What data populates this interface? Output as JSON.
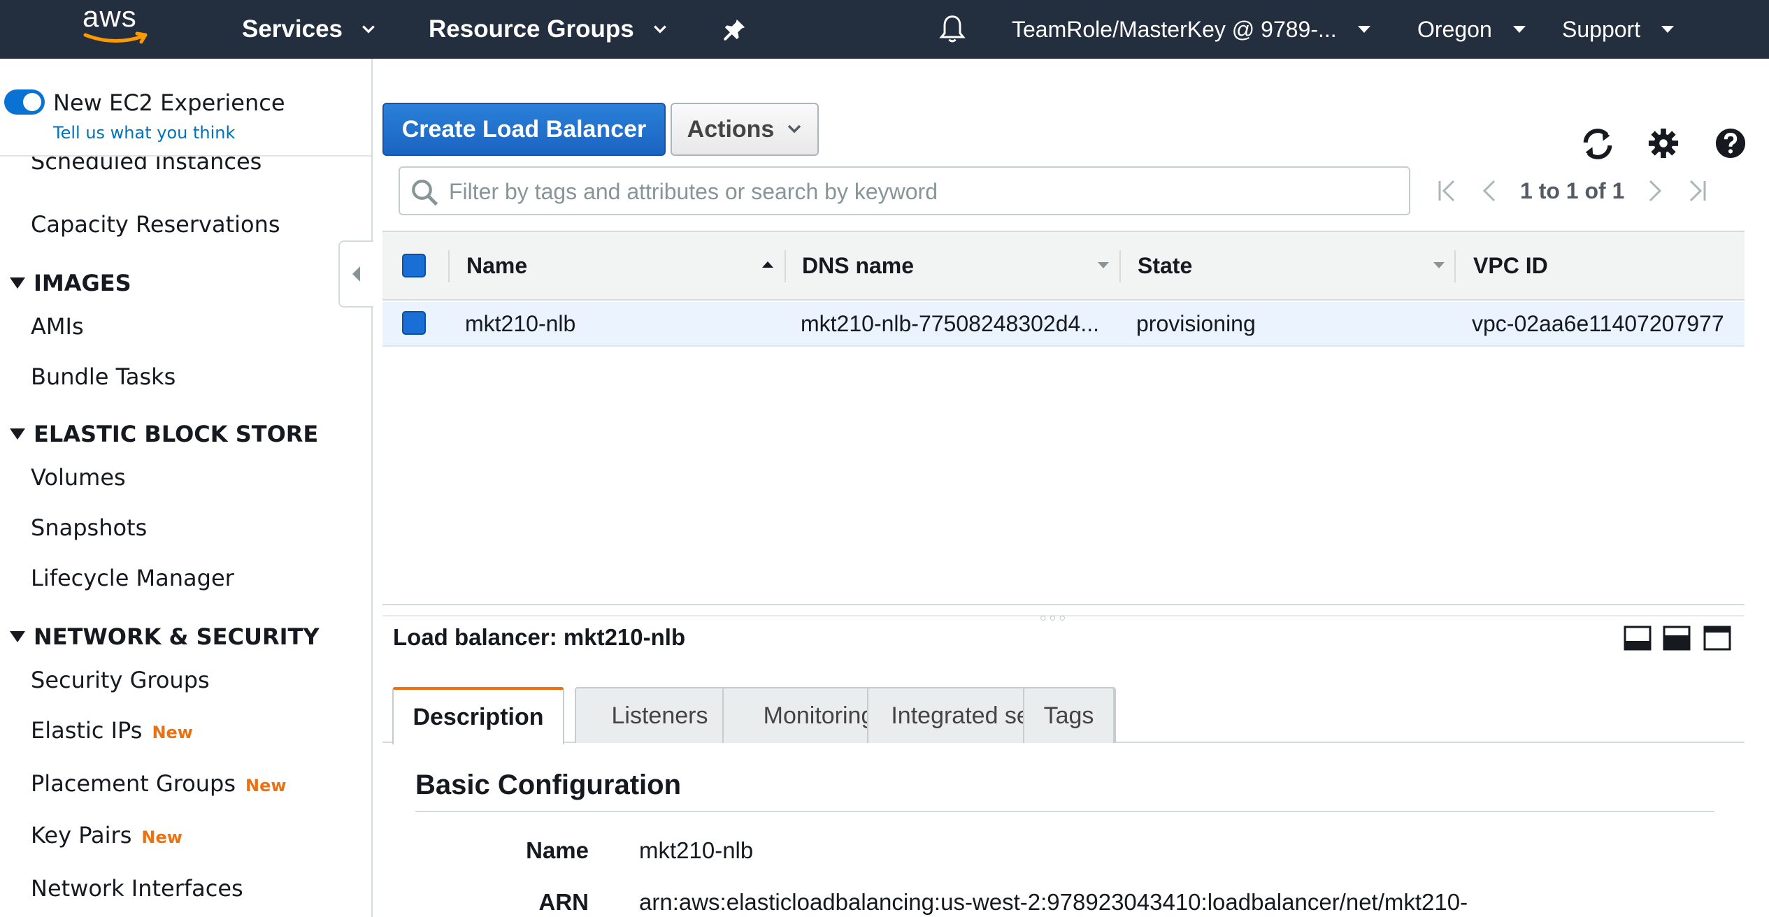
{
  "topnav": {
    "logo": "aws",
    "services": "Services",
    "resource_groups": "Resource Groups",
    "account": "TeamRole/MasterKey @ 9789-...",
    "region": "Oregon",
    "support": "Support",
    "icons": {
      "pin": "pin-icon",
      "bell": "bell-icon"
    }
  },
  "sidebar": {
    "toggle_label": "New EC2 Experience",
    "toggle_link": "Tell us what you think",
    "toggle_on": true,
    "items": {
      "scheduled_instances": "Scheduled Instances",
      "capacity_reservations": "Capacity Reservations",
      "images_header": "IMAGES",
      "amis": "AMIs",
      "bundle_tasks": "Bundle Tasks",
      "ebs_header": "ELASTIC BLOCK STORE",
      "volumes": "Volumes",
      "snapshots": "Snapshots",
      "lifecycle_manager": "Lifecycle Manager",
      "netsec_header": "NETWORK & SECURITY",
      "security_groups": "Security Groups",
      "elastic_ips": "Elastic IPs",
      "placement_groups": "Placement Groups",
      "key_pairs": "Key Pairs",
      "network_interfaces": "Network Interfaces"
    },
    "new_badge": "New"
  },
  "toolbar": {
    "create_label": "Create Load Balancer",
    "actions_label": "Actions"
  },
  "filter": {
    "placeholder": "Filter by tags and attributes or search by keyword",
    "value": ""
  },
  "pager": {
    "text": "1 to 1 of 1"
  },
  "table": {
    "columns": [
      "Name",
      "DNS name",
      "State",
      "VPC ID"
    ],
    "rows": [
      {
        "name": "mkt210-nlb",
        "dns": "mkt210-nlb-77508248302d4...",
        "state": "provisioning",
        "vpc": "vpc-02aa6e11407207977"
      }
    ]
  },
  "detail": {
    "title": "Load balancer: mkt210-nlb",
    "tabs": [
      "Description",
      "Listeners",
      "Monitoring",
      "Integrated services",
      "Tags"
    ],
    "active_tab": "Description",
    "section_title": "Basic Configuration",
    "fields": [
      {
        "key": "Name",
        "value": "mkt210-nlb"
      },
      {
        "key": "ARN",
        "value": "arn:aws:elasticloadbalancing:us-west-2:978923043410:loadbalancer/net/mkt210-"
      }
    ]
  },
  "colors": {
    "nav_bg": "#232f3e",
    "primary": "#1b64c1",
    "accent": "#ec7211",
    "link": "#0073bb",
    "row_selected": "#eaf3fe"
  }
}
